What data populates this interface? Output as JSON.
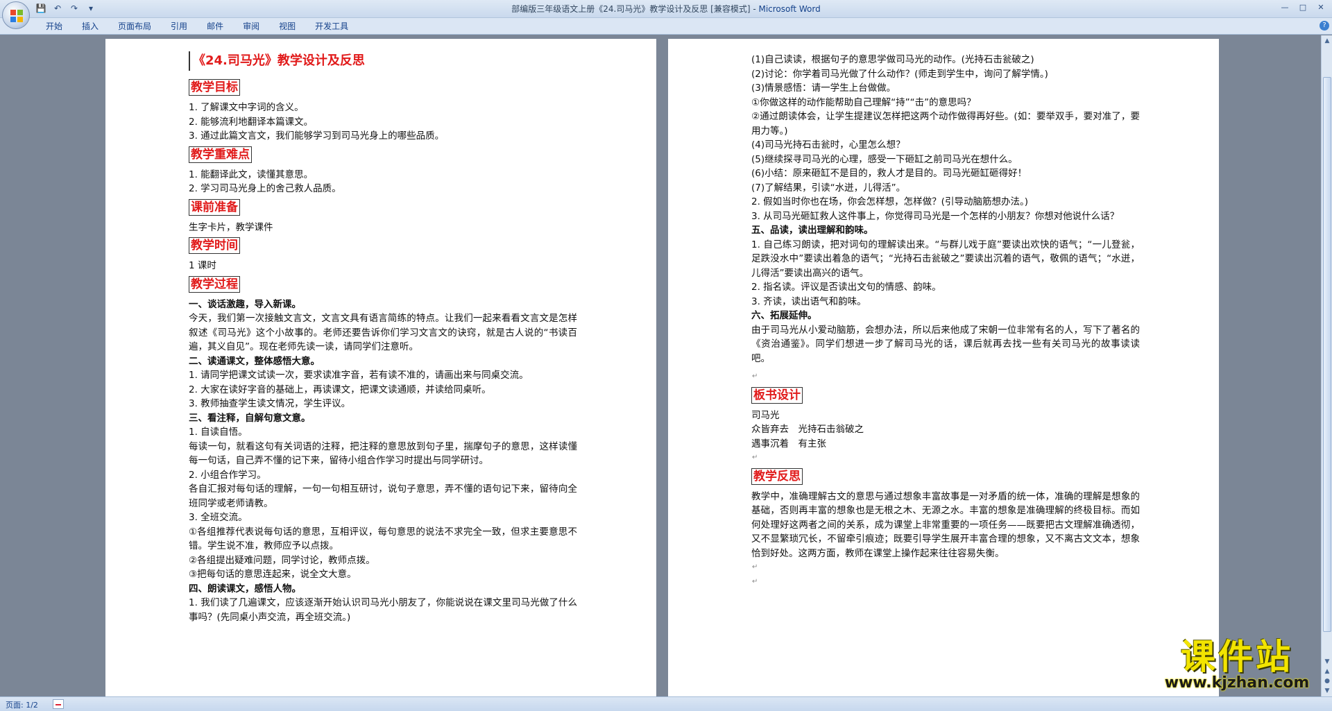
{
  "window": {
    "title": "部编版三年级语文上册《24.司马光》教学设计及反思 [兼容模式] - ",
    "app_name": "Microsoft Word"
  },
  "quick_access": {
    "save_icon": "save-icon",
    "undo_icon": "undo-icon",
    "redo_icon": "redo-icon",
    "customize_icon": "dropdown-icon"
  },
  "ribbon": {
    "tabs": [
      "开始",
      "插入",
      "页面布局",
      "引用",
      "邮件",
      "审阅",
      "视图",
      "开发工具"
    ]
  },
  "page1": {
    "title": "《24.司马光》教学设计及反思",
    "h_goal": "教学目标",
    "goal": [
      "1. 了解课文中字词的含义。",
      "2. 能够流利地翻译本篇课文。",
      "3. 通过此篇文言文，我们能够学习到司马光身上的哪些品质。"
    ],
    "h_key": "教学重难点",
    "key": [
      "1. 能翻译此文，读懂其意思。",
      "2. 学习司马光身上的舍己救人品质。"
    ],
    "h_prep": "课前准备",
    "prep": "生字卡片，教学课件",
    "h_time": "教学时间",
    "time": "1 课时",
    "h_process": "教学过程",
    "p_s1": "一、谈话激趣，导入新课。",
    "p_s1_text": "今天，我们第一次接触文言文，文言文具有语言简练的特点。让我们一起来看看文言文是怎样叙述《司马光》这个小故事的。老师还要告诉你们学习文言文的诀窍，就是古人说的“书读百遍，其义自见”。现在老师先读一读，请同学们注意听。",
    "p_s2": "二、读通课文，整体感悟大意。",
    "p_s2_1": "1. 请同学把课文试读一次，要求读准字音，若有读不准的，请画出来与同桌交流。",
    "p_s2_2": "2. 大家在读好字音的基础上，再读课文，把课文读通顺，并读给同桌听。",
    "p_s2_3": "3. 教师抽查学生读文情况，学生评议。",
    "p_s3": "三、看注释，自解句意文意。",
    "p_s3_1": "1. 自读自悟。",
    "p_s3_1_text": "每读一句，就看这句有关词语的注释，把注释的意思放到句子里，揣摩句子的意思，这样读懂每一句话，自己弄不懂的记下来，留待小组合作学习时提出与同学研讨。",
    "p_s3_2": "2. 小组合作学习。",
    "p_s3_2_text": "各自汇报对每句话的理解，一句一句相互研讨，说句子意思，弄不懂的语句记下来，留待向全班同学或老师请教。",
    "p_s3_3": "3. 全班交流。",
    "p_s3_3_a": "①各组推荐代表说每句话的意思，互相评议，每句意思的说法不求完全一致，但求主要意思不错。学生说不准，教师应予以点拨。",
    "p_s3_3_b": "②各组提出疑难问题，同学讨论，教师点拨。",
    "p_s3_3_c": "③把每句话的意思连起来，说全文大意。",
    "p_s4": "四、朗读课文，感悟人物。",
    "p_s4_1": "1. 我们读了几遍课文，应该逐渐开始认识司马光小朋友了，你能说说在课文里司马光做了什么事吗？(先同桌小声交流，再全班交流。)"
  },
  "page2": {
    "l1": "(1)自己读读，根据句子的意思学做司马光的动作。(光持石击瓮破之)",
    "l2": "(2)讨论：你学着司马光做了什么动作？(师走到学生中，询问了解学情。)",
    "l3": "(3)情景感悟：请一学生上台做做。",
    "l4": "①你做这样的动作能帮助自己理解“持”“击”的意思吗？",
    "l5": "②通过朗读体会，让学生提建议怎样把这两个动作做得再好些。(如：要举双手，要对准了，要用力等。)",
    "l6": "(4)司马光持石击瓮时，心里怎么想？",
    "l7": "(5)继续探寻司马光的心理，感受一下砸缸之前司马光在想什么。",
    "l8": "(6)小结：原来砸缸不是目的，救人才是目的。司马光砸缸砸得好！",
    "l9": "(7)了解结果，引读“水迸，儿得活”。",
    "l10": "2. 假如当时你也在场，你会怎样想，怎样做？(引导动脑筋想办法。)",
    "l11": "3. 从司马光砸缸救人这件事上，你觉得司马光是一个怎样的小朋友？你想对他说什么话？",
    "s5": "五、品读，读出理解和韵味。",
    "s5_1": "1. 自己练习朗读，把对词句的理解读出来。“与群儿戏于庭”要读出欢快的语气；“一儿登瓮，足跌没水中”要读出着急的语气；“光持石击瓮破之”要读出沉着的语气，敬佩的语气；“水迸，儿得活”要读出高兴的语气。",
    "s5_2": "2. 指名读。评议是否读出文句的情感、韵味。",
    "s5_3": "3. 齐读，读出语气和韵味。",
    "s6": "六、拓展延伸。",
    "s6_text": "由于司马光从小爱动脑筋，会想办法，所以后来他成了宋朝一位非常有名的人，写下了著名的《资治通鉴》。同学们想进一步了解司马光的话，课后就再去找一些有关司马光的故事读读吧。",
    "h_board": "板书设计",
    "board1": "司马光",
    "board2": "众皆弃去　光持石击翁破之",
    "board3": "遇事沉着　有主张",
    "h_reflect": "教学反思",
    "reflect": "教学中，准确理解古文的意思与通过想象丰富故事是一对矛盾的统一体，准确的理解是想象的基础，否则再丰富的想象也是无根之木、无源之水。丰富的想象是准确理解的终极目标。而如何处理好这两者之间的关系，成为课堂上非常重要的一项任务——既要把古文理解准确透彻，又不显繁琐冗长，不留牵引痕迹；既要引导学生展开丰富合理的想象，又不离古文文本，想象恰到好处。这两方面，教师在课堂上操作起来往往容易失衡。"
  },
  "status": {
    "page": "页面: 1/2"
  },
  "watermark": {
    "title": "课件站",
    "url": "www.kjzhan.com"
  }
}
